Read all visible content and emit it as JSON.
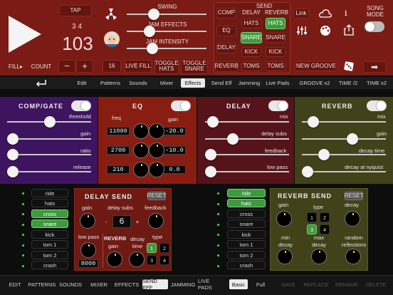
{
  "header": {
    "tap": "TAP",
    "time_sig": "3 4",
    "tempo": "103",
    "fill": "FILL▸",
    "count": "COUNT",
    "minus": "−",
    "plus": "+",
    "swing_label": "SWING",
    "swing_level": 0.45,
    "jam_effects_label": "JAM EFFECTS",
    "jam_effects_level": 0.22,
    "jam_intensity_label": "JAM INTENSITY",
    "jam_intensity_level": 0.3,
    "sixteen": "16",
    "live_fill": "LIVE FILL",
    "toggle_hats": "TOGGLE HATS",
    "toggle_snare": "TOGGLE SNARE",
    "send_title": "SEND",
    "comp": "COMP",
    "eq": "EQ",
    "delay": "DELAY",
    "reverb_btn": "REVERB",
    "delay_col": "DELAY",
    "reverb_col": "REVERB",
    "d_hats": "HATS",
    "d_snare": "SNARE",
    "d_kick": "KICK",
    "d_toms": "TOMS",
    "r_hats": "HATS",
    "r_snare": "SNARE",
    "r_kick": "KICK",
    "r_toms": "TOMS",
    "link": "Link",
    "song_mode": "SONG MODE",
    "new_groove": "NEW GROOVE"
  },
  "tabs": {
    "edit": "Edit",
    "patterns": "Patterns",
    "sounds": "Sounds",
    "mixer": "Mixer",
    "effects": "Effects",
    "send_eff": "Send Eff",
    "jamming": "Jamming",
    "live_pads": "Live Pads",
    "groove_x2": "GROOVE x2",
    "time_half": "TIME /2",
    "time_x2": "TIME x2"
  },
  "comp": {
    "title": "COMP/GATE",
    "threshold": "threshold",
    "gain": "gain",
    "ratio": "ratio",
    "release": "release"
  },
  "eq": {
    "title": "EQ",
    "freq": "freq",
    "gain": "gain",
    "f1": "11000",
    "g1": "-20.0",
    "f2": "2700",
    "g2": "-10.0",
    "f3": "210",
    "g3": "0.0"
  },
  "delay": {
    "title": "DELAY",
    "mix": "mix",
    "subs": "delay subs",
    "feedback": "feedback",
    "lowpass": "low pass"
  },
  "reverb": {
    "title": "REVERB",
    "mix": "mix",
    "gain": "gain",
    "decay_time": "decay time",
    "decay_nyquist": "decay at nyquist"
  },
  "rows_left": [
    "ride",
    "hats",
    "cross",
    "snare",
    "kick",
    "tom 1",
    "tom 2",
    "crash"
  ],
  "rows_right": [
    "ride",
    "hats",
    "cross",
    "snare",
    "kick",
    "tom 1",
    "tom 2",
    "crash"
  ],
  "delay_send": {
    "title": "DELAY SEND",
    "reset": "RESET",
    "gain": "gain",
    "subs": "delay subs",
    "feedback": "feedback",
    "minus": "-",
    "value": "6",
    "plus": "+",
    "lowpass": "low pass",
    "reverb": "REVERB",
    "reverb_gain": "gain",
    "decay_time": "decay time",
    "type": "type",
    "lp_value": "8000",
    "t1": "1",
    "t2": "2",
    "t3": "3",
    "t4": "4"
  },
  "reverb_send": {
    "title": "REVERB SEND",
    "reset": "RESET",
    "gain": "gain",
    "type": "type",
    "decay": "decay",
    "min_decay": "min decay",
    "max_decay": "max decay",
    "random": "random reflections",
    "t1": "1",
    "t2": "2",
    "t3": "3",
    "t4": "4"
  },
  "bottom": {
    "edit": "EDIT",
    "patterns": "PATTERNS",
    "sounds": "SOUNDS",
    "mixer": "MIXER",
    "effects": "EFFECTS",
    "send_eff": "SEND EFF",
    "jamming": "JAMMING",
    "live_pads": "LIVE PADS",
    "basic": "Basic",
    "full": "Full",
    "save": "SAVE",
    "replace": "REPLACE",
    "rename": "RENAME",
    "delete": "DELETE"
  }
}
